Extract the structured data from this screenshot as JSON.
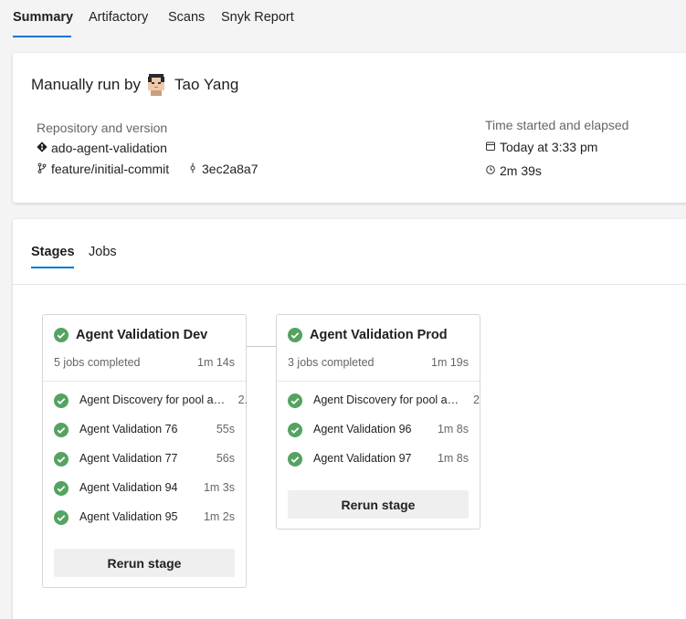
{
  "tabs": [
    {
      "label": "Summary",
      "active": true
    },
    {
      "label": "Artifactory",
      "active": false
    },
    {
      "label": "Scans",
      "active": false
    },
    {
      "label": "Snyk Report",
      "active": false
    }
  ],
  "summary": {
    "run_prefix": "Manually run by",
    "user_name": "Tao Yang",
    "repo_section_label": "Repository and version",
    "repo_name": "ado-agent-validation",
    "branch": "feature/initial-commit",
    "commit": "3ec2a8a7",
    "time_section_label": "Time started and elapsed",
    "started": "Today at 3:33 pm",
    "elapsed": "2m 39s"
  },
  "inner_tabs": [
    {
      "label": "Stages",
      "active": true
    },
    {
      "label": "Jobs",
      "active": false
    }
  ],
  "stages": [
    {
      "name": "Agent Validation Dev",
      "jobs_completed": "5 jobs completed",
      "duration": "1m 14s",
      "jobs": [
        {
          "name": "Agent Discovery for pool a…",
          "time": "2."
        },
        {
          "name": "Agent Validation 76",
          "time": "55s"
        },
        {
          "name": "Agent Validation 77",
          "time": "56s"
        },
        {
          "name": "Agent Validation 94",
          "time": "1m 3s"
        },
        {
          "name": "Agent Validation 95",
          "time": "1m 2s"
        }
      ],
      "rerun_label": "Rerun stage"
    },
    {
      "name": "Agent Validation Prod",
      "jobs_completed": "3 jobs completed",
      "duration": "1m 19s",
      "jobs": [
        {
          "name": "Agent Discovery for pool a…",
          "time": "2"
        },
        {
          "name": "Agent Validation 96",
          "time": "1m 8s"
        },
        {
          "name": "Agent Validation 97",
          "time": "1m 8s"
        }
      ],
      "rerun_label": "Rerun stage"
    }
  ],
  "colors": {
    "accent": "#0078d4",
    "success": "#55a362"
  },
  "icons": {
    "repo": "git-repo-icon",
    "branch": "branch-icon",
    "commit": "commit-icon",
    "calendar": "calendar-icon",
    "clock": "clock-icon",
    "status": "success-check-icon"
  }
}
